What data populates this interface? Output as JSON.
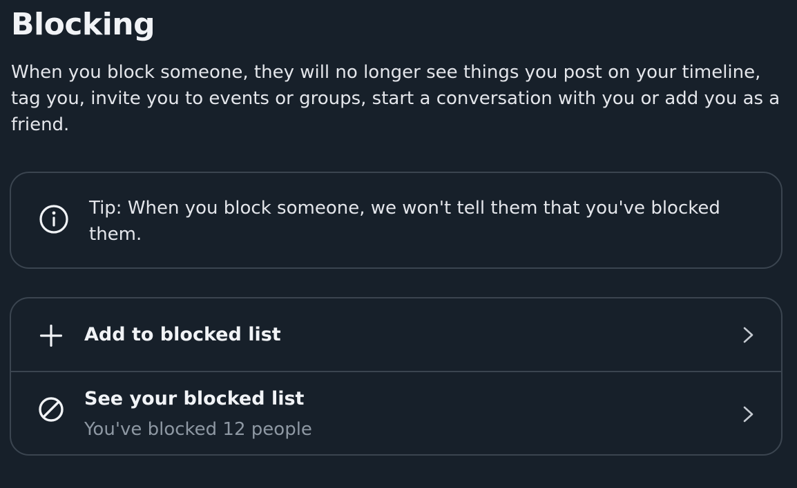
{
  "page": {
    "title": "Blocking",
    "description": "When you block someone, they will no longer see things you post on your timeline, tag you, invite you to events or groups, start a conversation with you or add you as a friend."
  },
  "tip": {
    "icon": "info-icon",
    "text": "Tip: When you block someone, we won't tell them that you've blocked them."
  },
  "list": {
    "items": [
      {
        "icon": "plus-icon",
        "label": "Add to blocked list",
        "chevron": "chevron-right-icon"
      },
      {
        "icon": "block-icon",
        "label": "See your blocked list",
        "sublabel": "You've blocked 12 people",
        "chevron": "chevron-right-icon"
      }
    ]
  },
  "colors": {
    "background": "#17202a",
    "border": "#3b4550",
    "primary_text": "#e4e6eb",
    "secondary_text": "#8e98a3"
  }
}
